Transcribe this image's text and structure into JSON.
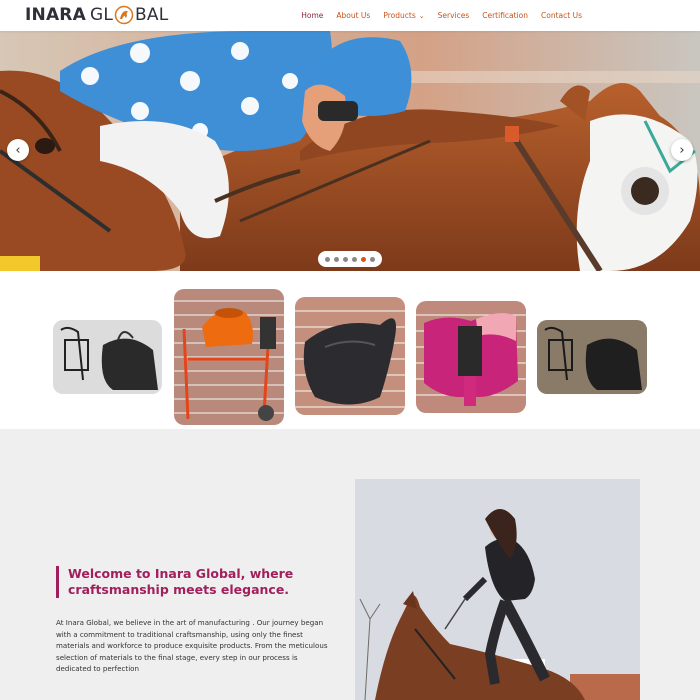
{
  "header": {
    "logo": {
      "part1": "INARA",
      "part2": "GL",
      "part3": "BAL"
    },
    "nav": [
      {
        "label": "Home"
      },
      {
        "label": "About Us"
      },
      {
        "label": "Products"
      },
      {
        "label": "Services"
      },
      {
        "label": "Certification"
      },
      {
        "label": "Contact Us"
      }
    ]
  },
  "hero": {
    "prev_icon": "chevron-left-icon",
    "next_icon": "chevron-right-icon",
    "slides": 6,
    "active_slide": 4
  },
  "products": [
    {
      "name": "bridle-and-saddle"
    },
    {
      "name": "orange-mixer"
    },
    {
      "name": "black-saddle"
    },
    {
      "name": "pink-saddle-pad"
    },
    {
      "name": "bridle-and-saddle-2"
    }
  ],
  "about": {
    "title": "Welcome to Inara Global, where craftsmanship meets elegance.",
    "body": "At Inara Global, we believe in the art of manufacturing . Our journey began with a commitment to traditional craftsmanship, using only the finest materials and workforce to produce exquisite  products. From the meticulous selection of materials to the final stage, every step in our process is dedicated to perfection"
  },
  "colors": {
    "accent": "#c7541a",
    "nav_active": "#8d2a3e",
    "title": "#a11f5d",
    "section_bg": "#efefef"
  }
}
